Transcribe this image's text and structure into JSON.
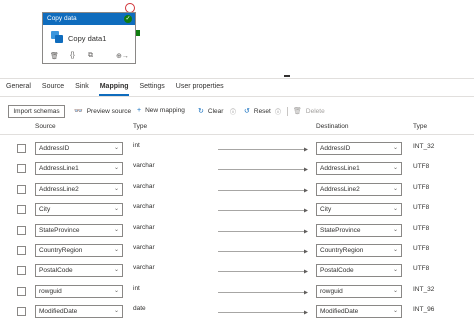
{
  "activity": {
    "title": "Copy data",
    "name": "Copy data1",
    "tools": [
      "🗑",
      "{}",
      "⧉",
      "⊕→"
    ]
  },
  "tabs": [
    {
      "label": "General",
      "active": false
    },
    {
      "label": "Source",
      "active": false
    },
    {
      "label": "Sink",
      "active": false
    },
    {
      "label": "Mapping",
      "active": true
    },
    {
      "label": "Settings",
      "active": false
    },
    {
      "label": "User properties",
      "active": false
    }
  ],
  "toolbar": {
    "import_schemas": "Import schemas",
    "preview_source": "Preview source",
    "new_mapping": "New mapping",
    "clear": "Clear",
    "reset": "Reset",
    "delete": "Delete"
  },
  "columns": {
    "source": "Source",
    "type": "Type",
    "destination": "Destination",
    "dest_type": "Type"
  },
  "mappings": [
    {
      "source": "AddressID",
      "source_type": "int",
      "destination": "AddressID",
      "dest_type": "INT_32"
    },
    {
      "source": "AddressLine1",
      "source_type": "varchar",
      "destination": "AddressLine1",
      "dest_type": "UTF8"
    },
    {
      "source": "AddressLine2",
      "source_type": "varchar",
      "destination": "AddressLine2",
      "dest_type": "UTF8"
    },
    {
      "source": "City",
      "source_type": "varchar",
      "destination": "City",
      "dest_type": "UTF8"
    },
    {
      "source": "StateProvince",
      "source_type": "varchar",
      "destination": "StateProvince",
      "dest_type": "UTF8"
    },
    {
      "source": "CountryRegion",
      "source_type": "varchar",
      "destination": "CountryRegion",
      "dest_type": "UTF8"
    },
    {
      "source": "PostalCode",
      "source_type": "varchar",
      "destination": "PostalCode",
      "dest_type": "UTF8"
    },
    {
      "source": "rowguid",
      "source_type": "int",
      "destination": "rowguid",
      "dest_type": "INT_32"
    },
    {
      "source": "ModifiedDate",
      "source_type": "date",
      "destination": "ModifiedDate",
      "dest_type": "INT_96"
    }
  ]
}
